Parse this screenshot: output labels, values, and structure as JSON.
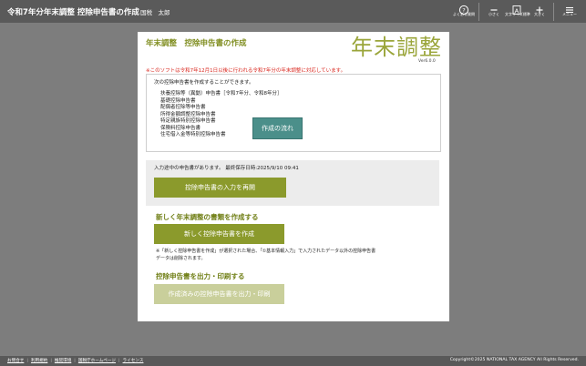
{
  "header": {
    "title": "令和7年分年末調整 控除申告書の作成",
    "user": "国税　太郎",
    "buttons": [
      {
        "label": "よくある質問",
        "icon": "question-icon"
      },
      {
        "label": "小さく",
        "icon": "minus-icon"
      },
      {
        "label": "文字サイズ標準",
        "icon": "font-size-icon"
      },
      {
        "label": "大きく",
        "icon": "plus-icon"
      },
      {
        "label": "メニュー",
        "icon": "hamburger-menu-icon"
      }
    ]
  },
  "main": {
    "title": "年末調整　控除申告書の作成",
    "logo_text": "年末調整",
    "version": "Ver6.0.0",
    "notice": "※このソフトは令和7年12月1日以後に行われる令和7年分の年末調整に対応しています。",
    "info": {
      "intro": "次の控除申告書を作成することができます。",
      "forms": [
        "扶養控除等（異動）申告書［令和7年分、令和8年分］",
        "基礎控除申告書",
        "配偶者控除等申告書",
        "所得金額調整控除申告書",
        "特定親族特別控除申告書",
        "保険料控除申告書",
        "住宅借入金等特別控除申告書"
      ],
      "flow_button": "作成の流れ"
    },
    "resume": {
      "message": "入力途中の申告書があります。 最終保存日時:2025/9/10 09:41",
      "button": "控除申告書の入力を再開"
    },
    "create": {
      "heading": "新しく年末調整の書類を作成する",
      "button": "新しく控除申告書を作成",
      "note_line1": "※「新しく控除申告書を作成」が選択された場合、「①基本情報入力」で入力されたデータ以外の控除申告書",
      "note_line2": "データは削除されます。"
    },
    "output": {
      "heading": "控除申告書を出力・印刷する",
      "button": "作成済みの控除申告書を出力・印刷"
    }
  },
  "footer": {
    "links": [
      "お問合せ",
      "利用規約",
      "推奨環境",
      "国税庁ホームページ",
      "ライセンス"
    ],
    "copyright": "Copyright©2025 NATIONAL TAX AGENCY All Rights Reserved."
  },
  "colors": {
    "accent": "#8b9a2c",
    "accent_disabled": "#c9cf9b",
    "teal": "#4b8f8a",
    "notice": "#d9251c",
    "header_bg": "#5a5a5a"
  }
}
